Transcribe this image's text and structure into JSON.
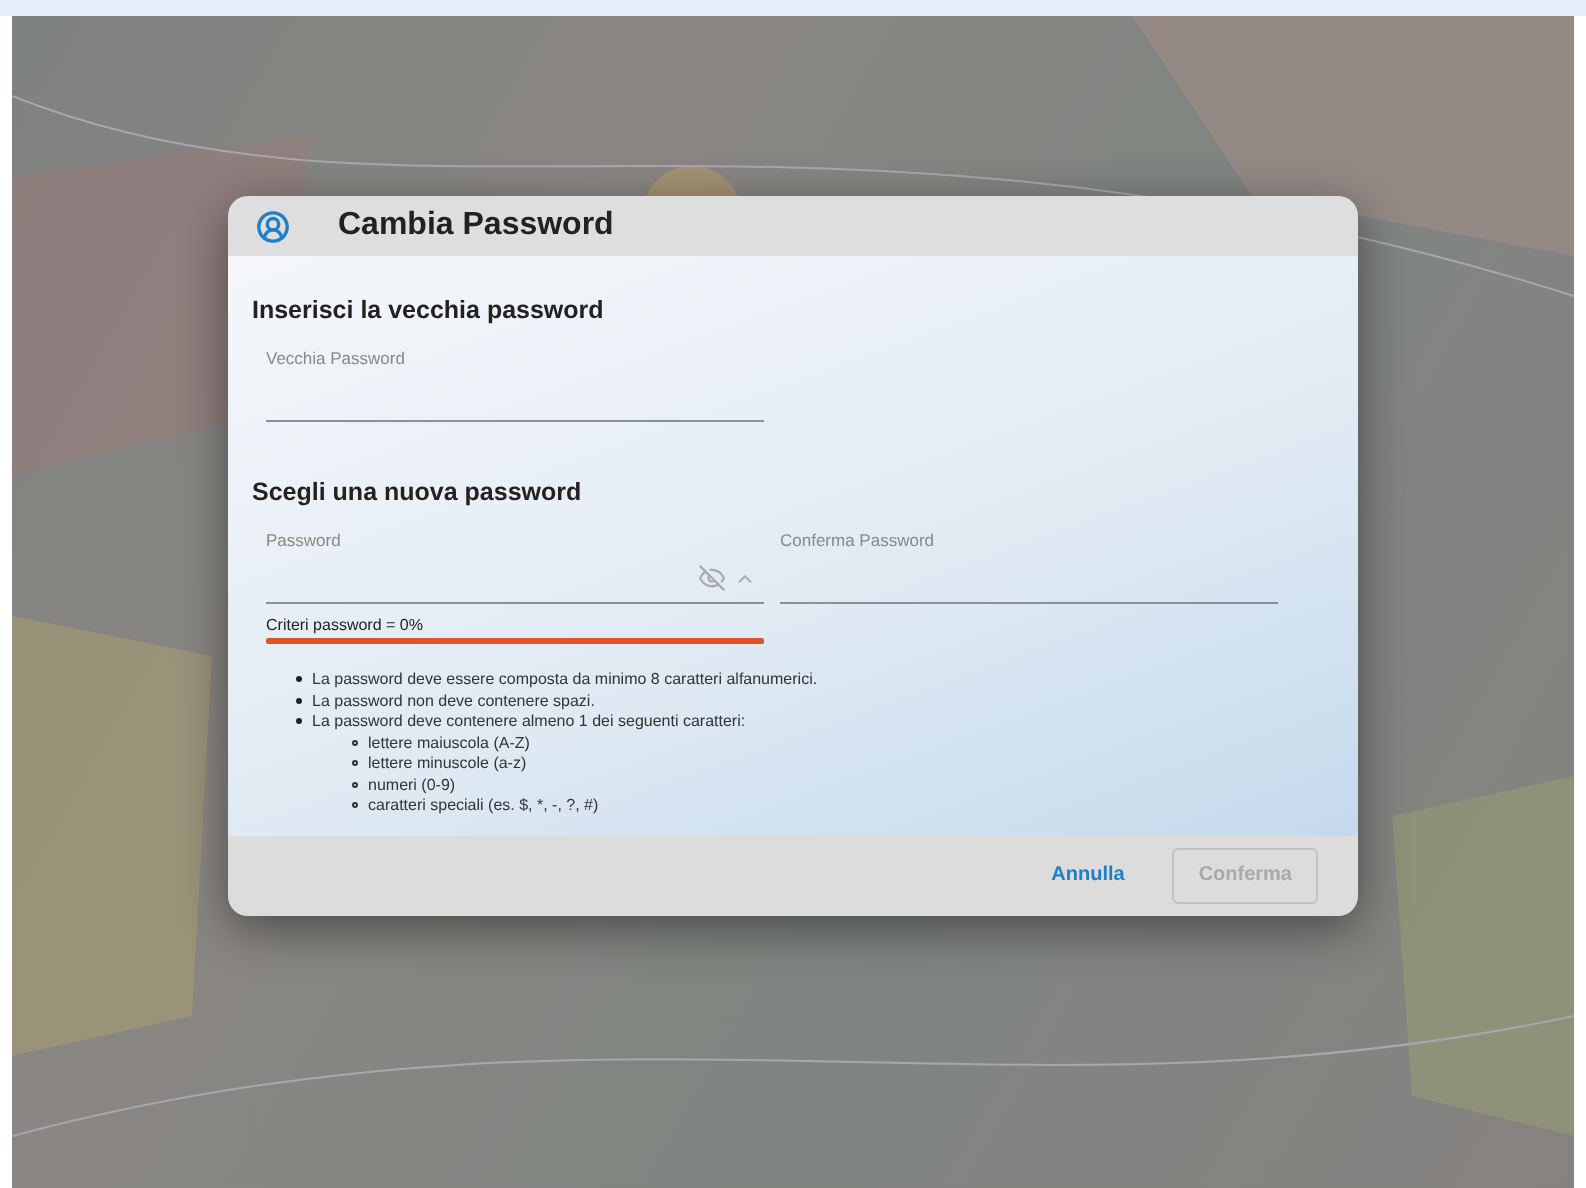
{
  "dialog": {
    "title": "Cambia Password",
    "old_section": {
      "heading": "Inserisci la vecchia password",
      "field": {
        "placeholder": "Vecchia Password"
      }
    },
    "new_section": {
      "heading": "Scegli una nuova password",
      "password": {
        "placeholder": "Password",
        "visible": false
      },
      "confirm": {
        "placeholder": "Conferma Password"
      },
      "criteria": "Criteri password = 0%",
      "rules": [
        {
          "text": "La password deve essere composta da minimo 8 caratteri alfanumerici."
        },
        {
          "text": "La password non deve contenere spazi."
        },
        {
          "text": "La password deve contenere almeno 1 dei seguenti caratteri:",
          "children": [
            {
              "text": "lettere maiuscola (A-Z)"
            },
            {
              "text": "lettere minuscole (a-z)"
            },
            {
              "text": "numeri (0-9)"
            },
            {
              "text": "caratteri speciali (es. $, *, -, ?, #)"
            }
          ]
        }
      ]
    },
    "buttons": [
      {
        "label": "Annulla",
        "kind": "text",
        "disabled": false
      },
      {
        "label": "Conferma",
        "kind": "outlined",
        "disabled": true
      }
    ]
  }
}
